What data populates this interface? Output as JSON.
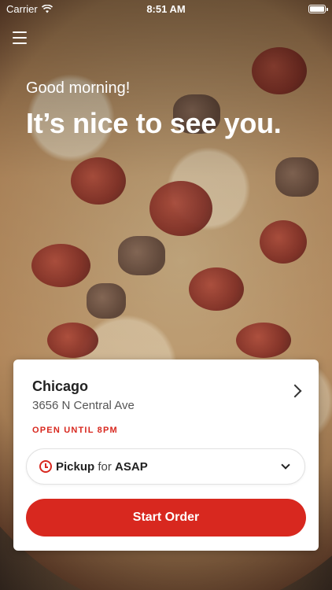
{
  "status_bar": {
    "carrier": "Carrier",
    "time": "8:51 AM"
  },
  "header": {
    "greeting": "Good morning!",
    "headline": "It’s nice to see you."
  },
  "location_card": {
    "city": "Chicago",
    "address": "3656 N Central Ave",
    "open_status": "OPEN UNTIL 8PM",
    "pickup": {
      "mode": "Pickup",
      "connector": "for",
      "time": "ASAP"
    },
    "start_order_label": "Start Order"
  },
  "colors": {
    "accent": "#d8281f",
    "card_bg": "#ffffff"
  },
  "icons": {
    "menu": "hamburger-menu-icon",
    "wifi": "wifi-icon",
    "battery": "battery-icon",
    "chevron_right": "chevron-right-icon",
    "clock": "clock-icon",
    "chevron_down": "chevron-down-icon"
  }
}
